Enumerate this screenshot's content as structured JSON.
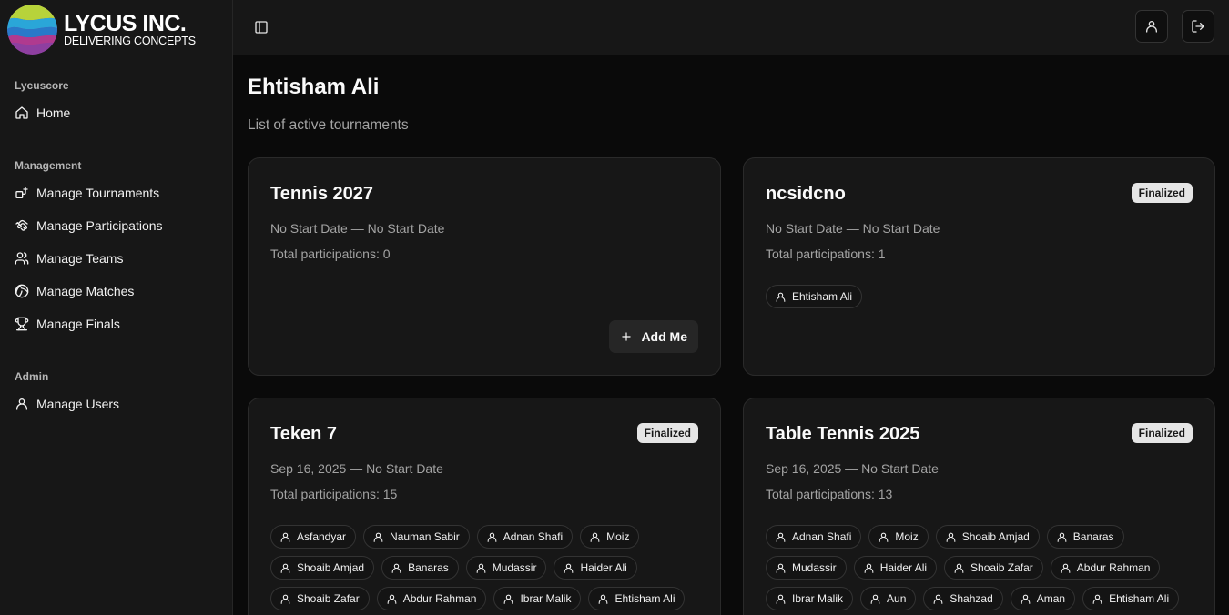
{
  "brand": {
    "name": "LYCUS INC.",
    "tagline": "DELIVERING CONCEPTS"
  },
  "sidebar": {
    "groups": [
      {
        "label": "Lycuscore",
        "items": [
          {
            "label": "Home",
            "icon": "home-icon"
          }
        ]
      },
      {
        "label": "Management",
        "items": [
          {
            "label": "Manage Tournaments",
            "icon": "tournament-icon"
          },
          {
            "label": "Manage Participations",
            "icon": "handshake-icon"
          },
          {
            "label": "Manage Teams",
            "icon": "users-icon"
          },
          {
            "label": "Manage Matches",
            "icon": "volleyball-icon"
          },
          {
            "label": "Manage Finals",
            "icon": "trophy-icon"
          }
        ]
      },
      {
        "label": "Admin",
        "items": [
          {
            "label": "Manage Users",
            "icon": "user-icon"
          }
        ]
      }
    ]
  },
  "header": {
    "toggle_icon": "panel-left-icon",
    "profile_icon": "user-icon",
    "logout_icon": "logout-icon"
  },
  "main": {
    "title": "Ehtisham Ali",
    "subtitle": "List of active tournaments",
    "tournaments": [
      {
        "name": "Tennis 2027",
        "badge": "",
        "dates": "No Start Date — No Start Date",
        "total": "Total participations: 0",
        "participants": [],
        "action": "Add Me"
      },
      {
        "name": "ncsidcno",
        "badge": "Finalized",
        "dates": "No Start Date — No Start Date",
        "total": "Total participations: 1",
        "participants": [
          "Ehtisham Ali"
        ]
      },
      {
        "name": "Teken 7",
        "badge": "Finalized",
        "dates": "Sep 16, 2025 — No Start Date",
        "total": "Total participations: 15",
        "participants": [
          "Asfandyar",
          "Nauman Sabir",
          "Adnan Shafi",
          "Moiz",
          "Shoaib Amjad",
          "Banaras",
          "Mudassir",
          "Haider Ali",
          "Shoaib Zafar",
          "Abdur Rahman",
          "Ibrar Malik",
          "Ehtisham Ali"
        ]
      },
      {
        "name": "Table Tennis 2025",
        "badge": "Finalized",
        "dates": "Sep 16, 2025 — No Start Date",
        "total": "Total participations: 13",
        "participants": [
          "Adnan Shafi",
          "Moiz",
          "Shoaib Amjad",
          "Banaras",
          "Mudassir",
          "Haider Ali",
          "Shoaib Zafar",
          "Abdur Rahman",
          "Ibrar Malik",
          "Aun",
          "Shahzad",
          "Aman",
          "Ehtisham Ali"
        ]
      }
    ]
  },
  "colors": {
    "background": "#0a0a0a",
    "sidebar": "#171717",
    "card": "#171717",
    "badge": "#e5e5e5",
    "muted_text": "#a3a3a3"
  }
}
